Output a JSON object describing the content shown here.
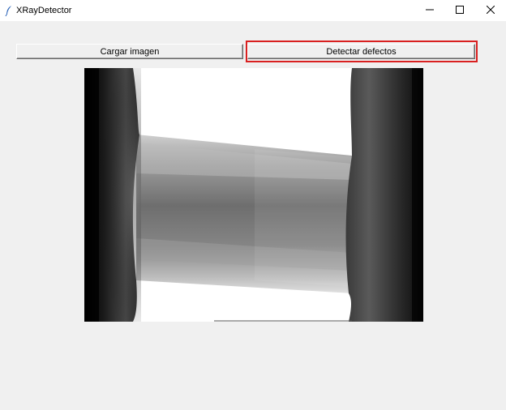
{
  "window": {
    "title": "XRayDetector",
    "icon": "feather-icon"
  },
  "controls": {
    "minimize_icon": "minimize-icon",
    "maximize_icon": "maximize-icon",
    "close_icon": "close-icon"
  },
  "toolbar": {
    "load_label": "Cargar imagen",
    "detect_label": "Detectar defectos",
    "highlight_color": "#d92020"
  },
  "image": {
    "type": "x-ray radiograph of cylindrical part"
  }
}
